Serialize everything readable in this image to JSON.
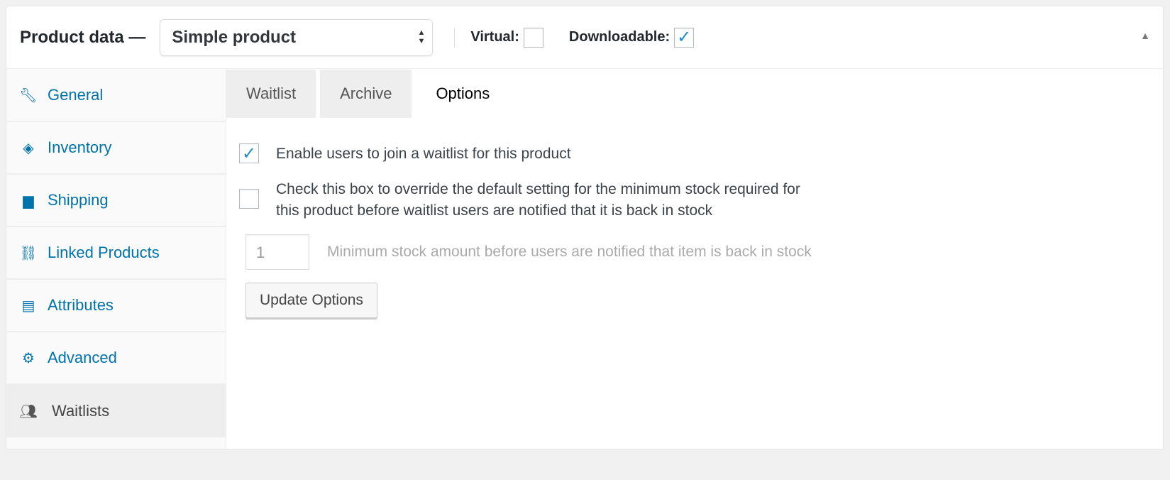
{
  "header": {
    "title": "Product data —",
    "product_type": "Simple product",
    "virtual_label": "Virtual:",
    "virtual_checked": false,
    "downloadable_label": "Downloadable:",
    "downloadable_checked": true
  },
  "sidebar": {
    "items": [
      {
        "label": "General",
        "icon": "wrench-icon"
      },
      {
        "label": "Inventory",
        "icon": "tag-icon"
      },
      {
        "label": "Shipping",
        "icon": "truck-icon"
      },
      {
        "label": "Linked Products",
        "icon": "link-icon"
      },
      {
        "label": "Attributes",
        "icon": "list-icon"
      },
      {
        "label": "Advanced",
        "icon": "gear-icon"
      },
      {
        "label": "Waitlists",
        "icon": "users-icon"
      }
    ]
  },
  "tabs": [
    "Waitlist",
    "Archive",
    "Options"
  ],
  "options": {
    "enable_label": "Enable users to join a waitlist for this product",
    "enable_checked": true,
    "override_label_1": "Check this box to override the default setting for the minimum stock required for",
    "override_label_2": "this product before waitlist users are notified that it is back in stock",
    "override_checked": false,
    "min_stock_placeholder": "1",
    "min_stock_label": "Minimum stock amount before users are notified that item is back in stock",
    "update_button": "Update Options"
  }
}
